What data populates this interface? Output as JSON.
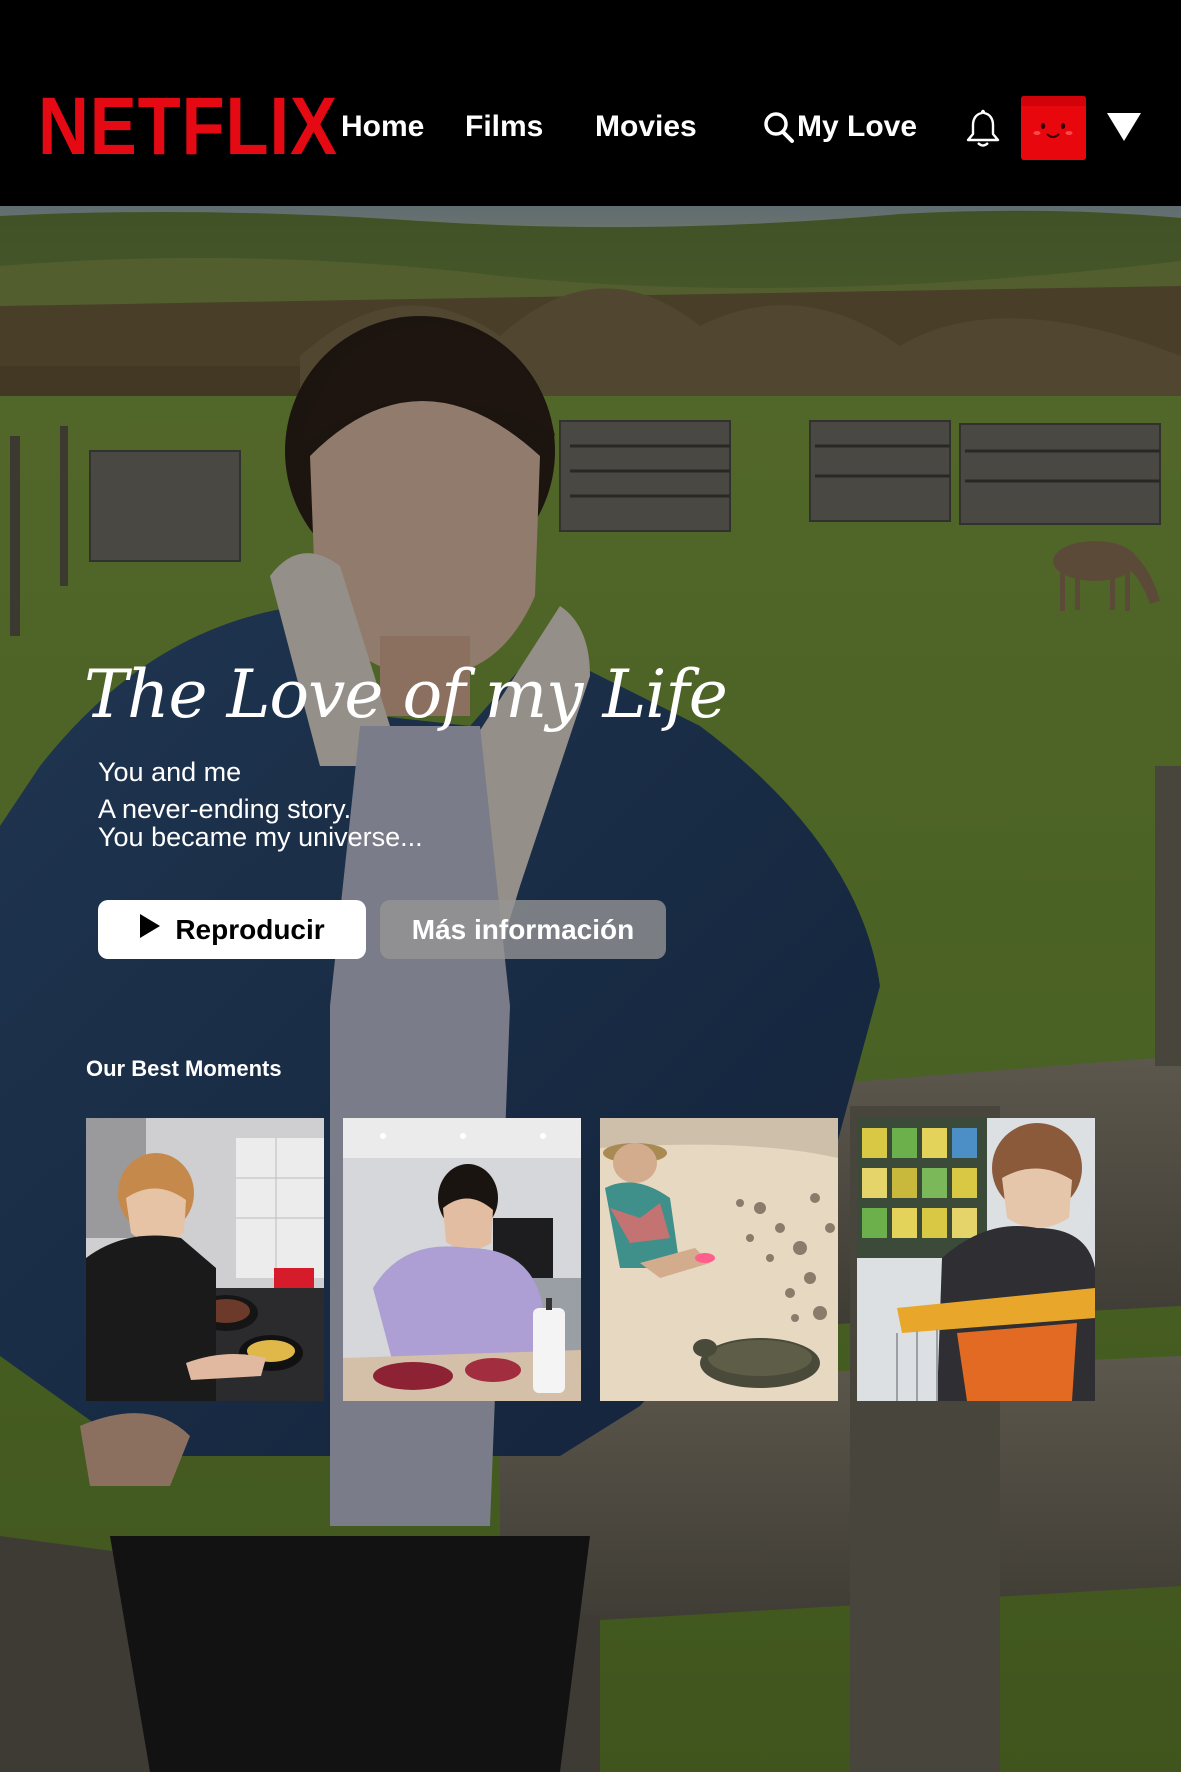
{
  "brand": {
    "logo_text": "NETFLIX",
    "color": "#e50914"
  },
  "nav": {
    "items": [
      {
        "label": "Home"
      },
      {
        "label": "Films"
      },
      {
        "label": "Movies"
      },
      {
        "label": "My Love",
        "icon": "search-icon"
      }
    ],
    "notifications_icon": "bell-icon",
    "avatar_icon": "smiley-face-icon",
    "avatar_color": "#e8070d",
    "menu_icon": "caret-down-icon"
  },
  "hero": {
    "title": "The Love of my Life",
    "lines": [
      "You and me",
      "A never-ending story.",
      "You became my universe..."
    ],
    "play_button": {
      "label": "Reproducir",
      "icon": "play-icon"
    },
    "info_button": {
      "label": "Más información"
    }
  },
  "row": {
    "title": "Our Best Moments",
    "items": [
      {
        "name": "kitchen-cooking-photo"
      },
      {
        "name": "cooking-meat-photo"
      },
      {
        "name": "beach-turtle-photo"
      },
      {
        "name": "supermarket-cart-photo"
      }
    ]
  },
  "colors": {
    "header_bg": "#000000",
    "play_button_bg": "#ffffff",
    "info_button_bg": "#969696"
  }
}
